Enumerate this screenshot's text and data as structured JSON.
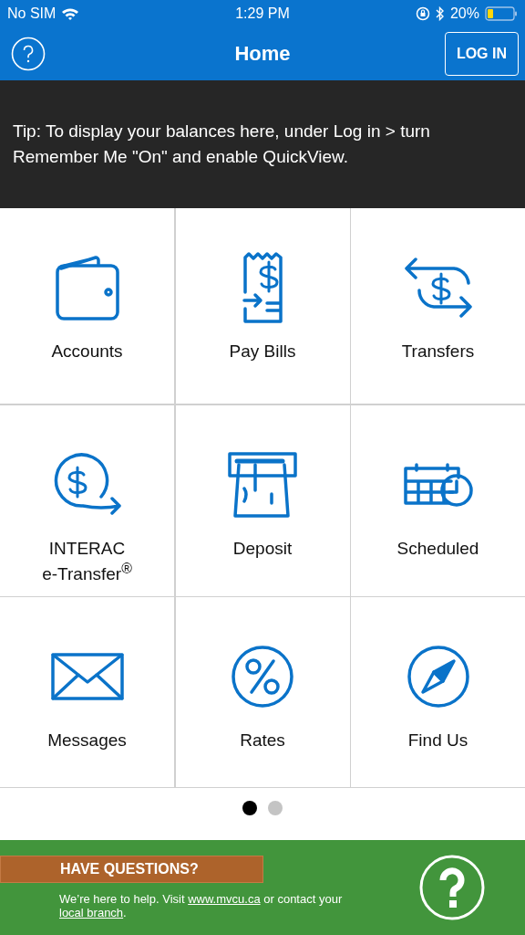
{
  "status_bar": {
    "carrier": "No SIM",
    "time": "1:29 PM",
    "battery": "20%"
  },
  "nav": {
    "title": "Home",
    "login": "LOG IN"
  },
  "tip": "Tip: To display your balances here, under Log in > turn Remember Me \"On\" and enable QuickView.",
  "tiles": [
    {
      "kind": "wallet",
      "label": "Accounts"
    },
    {
      "kind": "bill",
      "label": "Pay Bills"
    },
    {
      "kind": "transfer",
      "label": "Transfers"
    },
    {
      "kind": "etransfer",
      "label": "INTERAC\ne-Transfer$^{®}$"
    },
    {
      "kind": "deposit",
      "label": "Deposit"
    },
    {
      "kind": "calendar",
      "label": "Scheduled"
    },
    {
      "kind": "mail",
      "label": "Messages"
    },
    {
      "kind": "percent",
      "label": "Rates"
    },
    {
      "kind": "compass",
      "label": "Find Us"
    }
  ],
  "page_dots": [
    {
      "selected": true
    },
    {
      "selected": false
    }
  ],
  "help_banner": {
    "heading": "HAVE QUESTIONS?",
    "message": [
      {
        "text": "We’re here to help. Visit "
      },
      {
        "link": "www.mvcu.ca"
      },
      {
        "text": " or contact your "
      },
      {
        "link": "local branch"
      },
      {
        "text": "."
      }
    ]
  }
}
